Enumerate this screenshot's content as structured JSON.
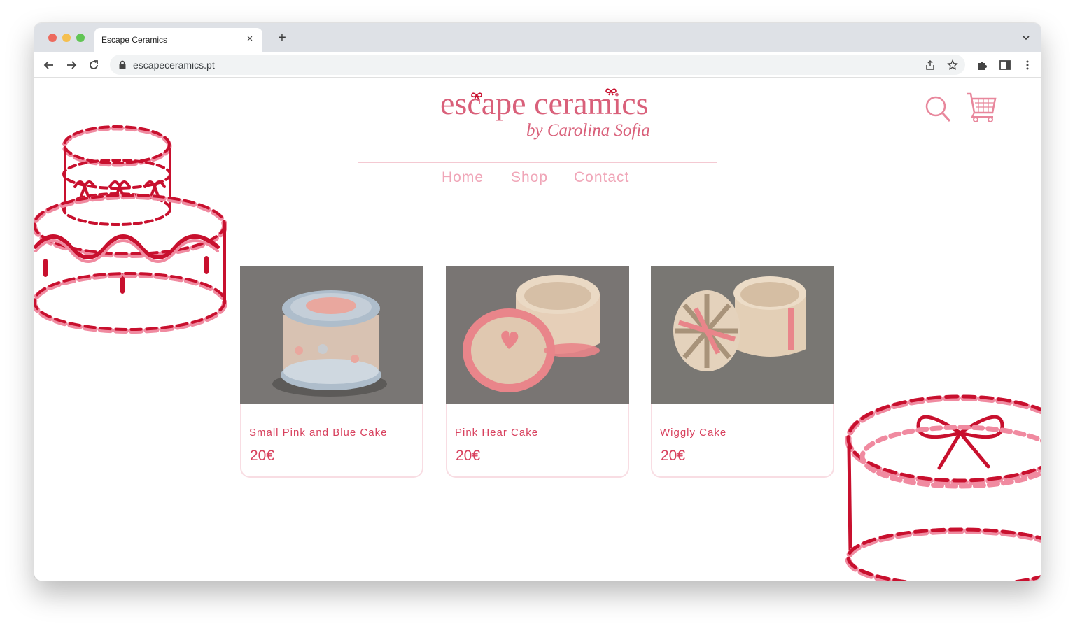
{
  "browser": {
    "tab_title": "Escape Ceramics",
    "tab_close": "×",
    "new_tab": "+",
    "url": "escapeceramics.pt"
  },
  "site": {
    "logo": {
      "title": "escape ceramics",
      "subtitle": "by Carolina Sofia"
    },
    "nav": {
      "home": "Home",
      "shop": "Shop",
      "contact": "Contact"
    },
    "colors": {
      "brand_pink": "#d9607a",
      "nav_pink": "#f0a6b8",
      "price_red": "#d8415e",
      "cake_red": "#c8102e"
    }
  },
  "products": [
    {
      "name": "Small Pink and Blue Cake",
      "price": "20€"
    },
    {
      "name": "Pink Hear Cake",
      "price": "20€"
    },
    {
      "name": "Wiggly Cake",
      "price": "20€"
    }
  ]
}
